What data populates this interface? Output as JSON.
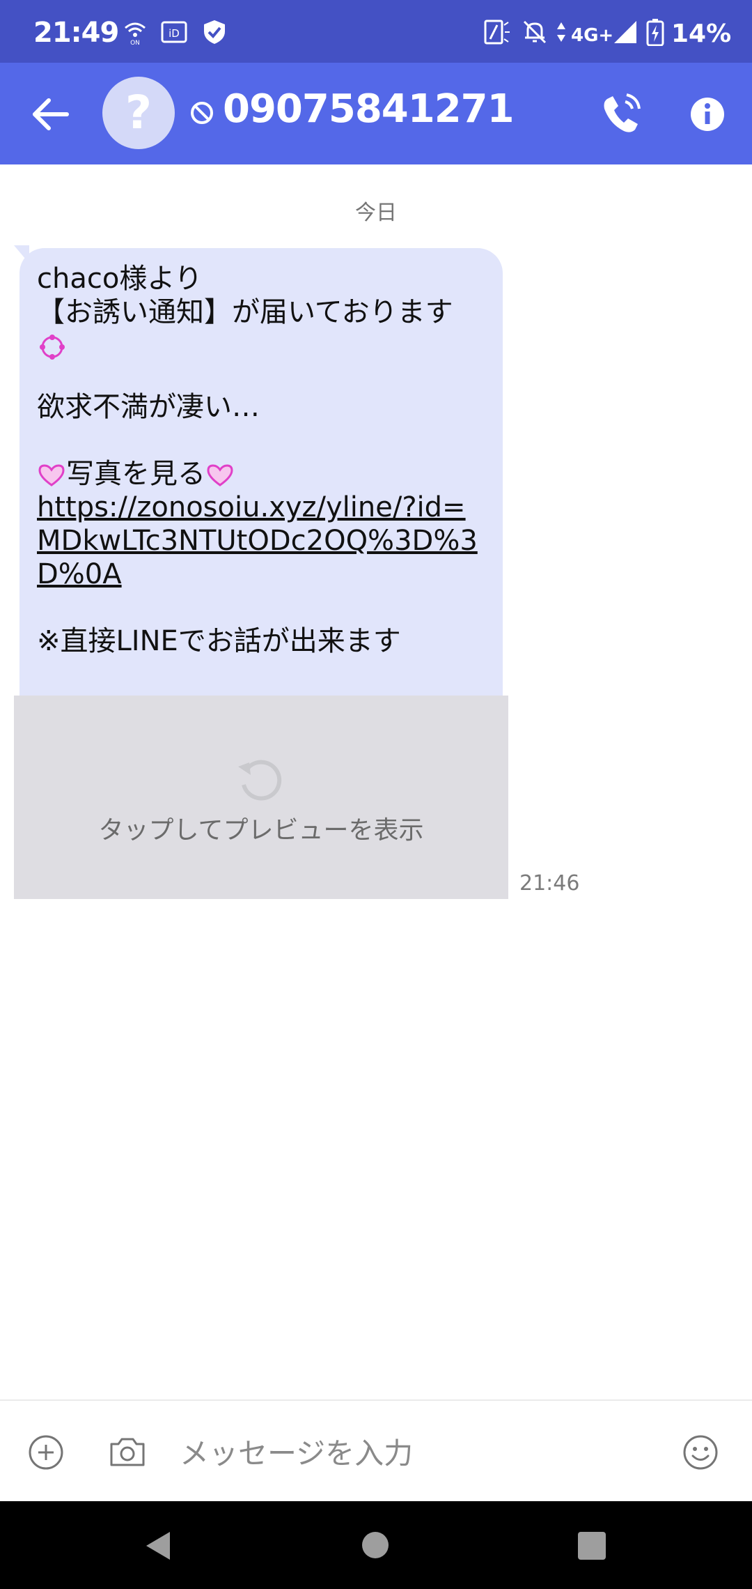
{
  "status_bar": {
    "time": "21:49",
    "network": "4G+",
    "battery": "14%",
    "icons": [
      "wifi-calling-icon",
      "id-icon",
      "shield-check-icon",
      "nfc-icon",
      "notifications-off-icon",
      "data-arrows-icon",
      "signal-icon",
      "battery-charging-icon"
    ]
  },
  "header": {
    "title": "09075841271",
    "avatar": "?",
    "icons": [
      "back-arrow-icon",
      "block-icon",
      "phone-call-icon",
      "info-icon"
    ]
  },
  "conversation": {
    "date_label": "今日",
    "message": {
      "line1": "chaco様より",
      "line2": "【お誘い通知】が届いております",
      "line3": "欲求不満が凄い…",
      "line4": "写真を見る",
      "link": "https://zonosoiu.xyz/yline/?id=MDkwLTc3NTUtODc2OQ%3D%3D%0A",
      "line5": "※直接LINEでお話が出来ます",
      "time": "21:46"
    },
    "preview": {
      "label": "タップしてプレビューを表示"
    }
  },
  "composer": {
    "placeholder": "メッセージを入力",
    "icons": [
      "add-icon",
      "camera-icon",
      "emoji-icon"
    ]
  },
  "colors": {
    "status_bar": "#4451c4",
    "app_bar": "#5468e8",
    "bubble": "#e1e5fb",
    "preview": "#dedde2",
    "heart": "#e040c8"
  }
}
